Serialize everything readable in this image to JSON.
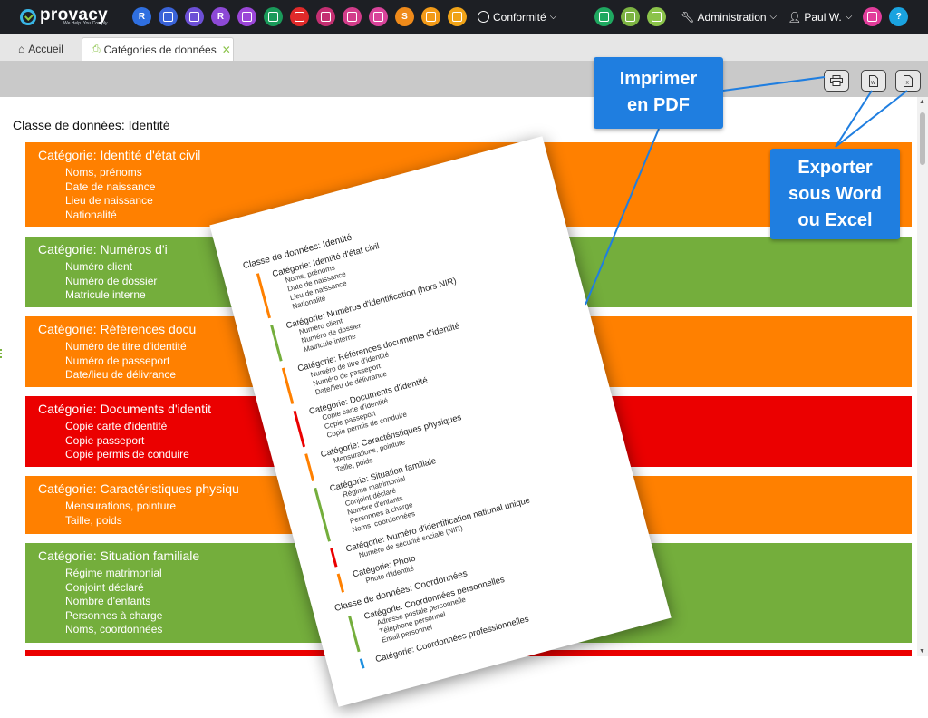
{
  "brand": {
    "name": "provacy",
    "tagline": "We Help. You Comply."
  },
  "topnav": {
    "icons_left": [
      {
        "label": "R",
        "color": "#2f6fe0",
        "icon": "r-icon"
      },
      {
        "label": "",
        "color": "#3a63d8",
        "icon": "network-icon"
      },
      {
        "label": "",
        "color": "#6c4fd6",
        "icon": "gear-cluster-icon"
      },
      {
        "label": "R",
        "color": "#8d49d6",
        "icon": "r2-icon"
      },
      {
        "label": "",
        "color": "#9b46d8",
        "icon": "handshake-icon"
      },
      {
        "label": "",
        "color": "#1a9a5a",
        "icon": "user-shield-icon"
      },
      {
        "label": "",
        "color": "#e02a2a",
        "icon": "shield-alert-icon"
      },
      {
        "label": "",
        "color": "#c42f72",
        "icon": "ai-chip-icon"
      },
      {
        "label": "",
        "color": "#d23c8a",
        "icon": "document-grid-icon"
      },
      {
        "label": "",
        "color": "#d8439a",
        "icon": "gift-icon"
      },
      {
        "label": "S",
        "color": "#ef8a1a",
        "icon": "s-icon"
      },
      {
        "label": "",
        "color": "#f29a18",
        "icon": "check-box-icon"
      },
      {
        "label": "",
        "color": "#f0a318",
        "icon": "share-icon"
      }
    ],
    "conformite": "Conformité",
    "icons_right": [
      {
        "color": "#1fa860",
        "icon": "people-icon"
      },
      {
        "color": "#7cb342",
        "icon": "team-icon"
      },
      {
        "color": "#8bc34a",
        "icon": "tools-icon"
      }
    ],
    "administration": "Administration",
    "user": "Paul W.",
    "extra_icons": [
      {
        "color": "#e23c9b",
        "icon": "rocket-icon"
      },
      {
        "color": "#1aa3e0",
        "icon": "help-icon",
        "label": "?"
      }
    ]
  },
  "tabs": {
    "home": "Accueil",
    "active": "Catégories de données"
  },
  "page": {
    "class_title": "Classe de données: Identité",
    "categories": [
      {
        "title": "Catégorie: Identité d'état civil",
        "color": "#ff8000",
        "items": [
          "Noms, prénoms",
          "Date de naissance",
          "Lieu de naissance",
          "Nationalité"
        ]
      },
      {
        "title": "Catégorie: Numéros d'i",
        "color": "#74ae3c",
        "items": [
          "Numéro client",
          "Numéro de dossier",
          "Matricule interne"
        ]
      },
      {
        "title": "Catégorie: Références docu",
        "color": "#ff8000",
        "items": [
          "Numéro de titre d'identité",
          "Numéro de passeport",
          "Date/lieu de délivrance"
        ]
      },
      {
        "title": "Catégorie: Documents d'identit",
        "color": "#eb0000",
        "items": [
          "Copie carte d'identité",
          "Copie passeport",
          "Copie permis de conduire"
        ]
      },
      {
        "title": "Catégorie: Caractéristiques physiqu",
        "color": "#ff8000",
        "items": [
          "Mensurations, pointure",
          "Taille, poids"
        ]
      },
      {
        "title": "Catégorie: Situation familiale",
        "color": "#74ae3c",
        "items": [
          "Régime matrimonial",
          "Conjoint déclaré",
          "Nombre d'enfants",
          "Personnes à charge",
          "Noms, coordonnées"
        ]
      },
      {
        "title": "",
        "color": "#eb0000",
        "items": []
      }
    ]
  },
  "paper": {
    "sections": [
      {
        "class": "Classe de données: Identité",
        "categories": [
          {
            "title": "Catégorie: Identité d'état civil",
            "color": "#ff8000",
            "items": [
              "Noms, prénoms",
              "Date de naissance",
              "Lieu de naissance",
              "Nationalité"
            ]
          },
          {
            "title": "Catégorie: Numéros d'identification (hors NIR)",
            "color": "#74ae3c",
            "items": [
              "Numéro client",
              "Numéro de dossier",
              "Matricule interne"
            ]
          },
          {
            "title": "Catégorie: Références documents d'identité",
            "color": "#ff8000",
            "items": [
              "Numéro de titre d'identité",
              "Numéro de passeport",
              "Date/lieu de délivrance"
            ]
          },
          {
            "title": "Catégorie: Documents d'identité",
            "color": "#eb0000",
            "items": [
              "Copie carte d'identité",
              "Copie passeport",
              "Copie permis de conduire"
            ]
          },
          {
            "title": "Catégorie: Caractéristiques physiques",
            "color": "#ff8000",
            "items": [
              "Mensurations, pointure",
              "Taille, poids"
            ]
          },
          {
            "title": "Catégorie: Situation familiale",
            "color": "#74ae3c",
            "items": [
              "Régime matrimonial",
              "Conjoint déclaré",
              "Nombre d'enfants",
              "Personnes à charge",
              "Noms, coordonnées"
            ]
          },
          {
            "title": "Catégorie: Numéro d'identification national unique",
            "color": "#eb0000",
            "items": [
              "Numéro de sécurité sociale (NIR)"
            ]
          },
          {
            "title": "Catégorie: Photo",
            "color": "#ff8000",
            "items": [
              "Photo d'identité"
            ]
          }
        ]
      },
      {
        "class": "Classe de données: Coordonnées",
        "categories": [
          {
            "title": "Catégorie: Coordonnées personnelles",
            "color": "#74ae3c",
            "items": [
              "Adresse postale personnelle",
              "Téléphone personnel",
              "Email personnel"
            ]
          },
          {
            "title": "Catégorie: Coordonnées professionnelles",
            "color": "#1e90e0",
            "items": []
          }
        ]
      }
    ]
  },
  "callouts": {
    "pdf": [
      "Imprimer",
      "en PDF"
    ],
    "export": [
      "Exporter",
      "sous Word",
      "ou Excel"
    ]
  }
}
